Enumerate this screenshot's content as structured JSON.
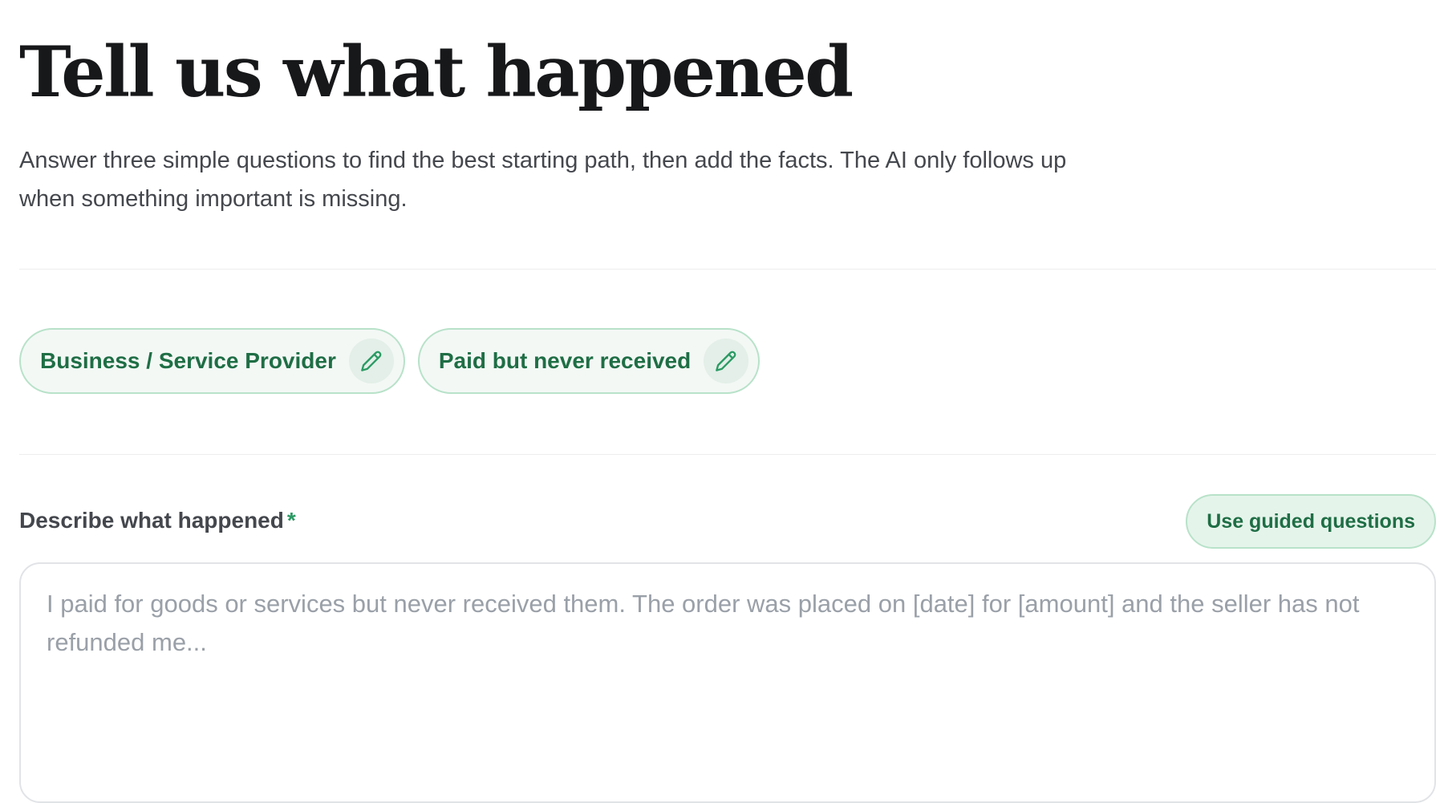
{
  "header": {
    "title": "Tell us what happened",
    "subtitle": "Answer three simple questions to find the best starting path, then add the facts. The AI only follows up when something important is missing."
  },
  "selections": [
    {
      "label": "Business / Service Provider",
      "icon": "pencil-icon"
    },
    {
      "label": "Paid but never received",
      "icon": "pencil-icon"
    }
  ],
  "description": {
    "label": "Describe what happened",
    "required_mark": "*",
    "guided_button_label": "Use guided questions",
    "value": "",
    "placeholder": "I paid for goods or services but never received them. The order was placed on [date] for [amount] and the seller has not refunded me..."
  },
  "colors": {
    "accent": "#1f6e45",
    "chip_border": "#b8e2c9",
    "chip_background": "#f3f8f5",
    "required": "#2a9a63"
  }
}
